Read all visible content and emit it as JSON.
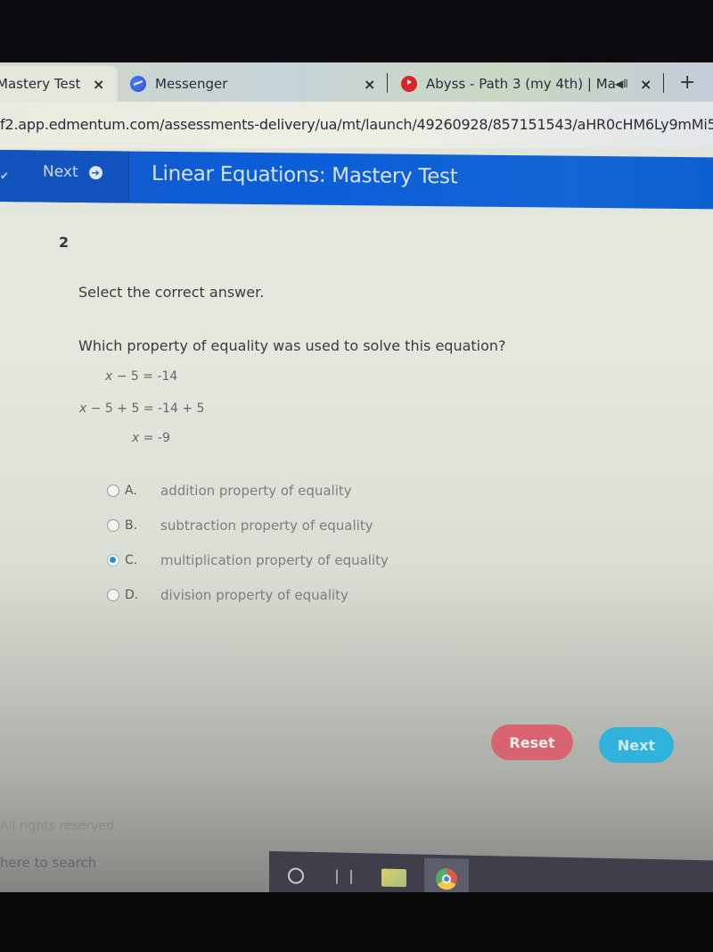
{
  "browser": {
    "tabs": [
      {
        "label": "Mastery Test",
        "active": true,
        "favicon": "none",
        "close_icon": "close-icon"
      },
      {
        "label": "Messenger",
        "active": false,
        "favicon": "messenger-icon",
        "close_icon": "close-icon"
      },
      {
        "label": "Abyss - Path 3 (my 4th) | Ma",
        "active": false,
        "favicon": "youtube-icon",
        "audio_icon": "speaker-icon",
        "close_icon": "close-icon"
      }
    ],
    "new_tab_label": "+",
    "close_glyph": "×",
    "url": "f2.app.edmentum.com/assessments-delivery/ua/mt/launch/49260928/857151543/aHR0cHM6Ly9mMi5"
  },
  "app": {
    "nav_next_label": "Next",
    "nav_next_icon": "➔",
    "title": "Linear Equations: Mastery Test",
    "accent_color": "#0b5ed8"
  },
  "question": {
    "number": "2",
    "instruction": "Select the correct answer.",
    "prompt": "Which property of equality was used to solve this equation?",
    "equations": [
      {
        "var": "x",
        "rest": " − 5 = -14"
      },
      {
        "var": "x",
        "rest": " − 5 + 5 = -14 + 5"
      },
      {
        "var": "x",
        "rest": " = -9"
      }
    ],
    "options": [
      {
        "letter": "A.",
        "text": "addition property of equality",
        "selected": false
      },
      {
        "letter": "B.",
        "text": "subtraction property of equality",
        "selected": false
      },
      {
        "letter": "C.",
        "text": "multiplication property of equality",
        "selected": true
      },
      {
        "letter": "D.",
        "text": "division property of equality",
        "selected": false
      }
    ]
  },
  "actions": {
    "reset_label": "Reset",
    "next_label": "Next",
    "reset_color": "#d8646f",
    "next_color": "#2fb3dd"
  },
  "footer": {
    "rights_text": "All rights reserved.",
    "search_text": "here to search"
  },
  "taskbar": {
    "icons": [
      "cortana-icon",
      "task-view-icon",
      "file-explorer-icon",
      "chrome-icon"
    ]
  }
}
